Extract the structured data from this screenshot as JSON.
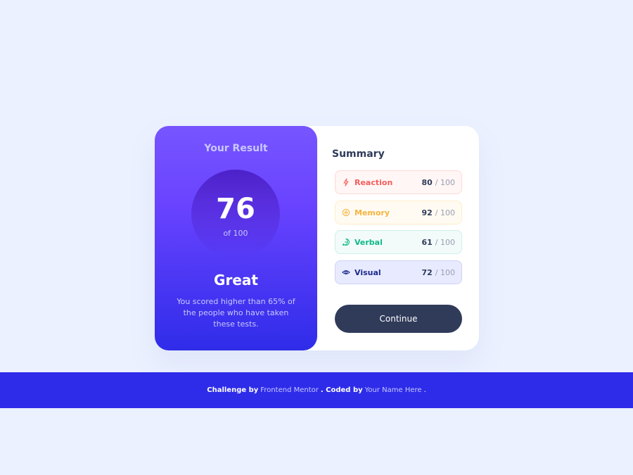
{
  "result": {
    "title": "Your Result",
    "score": "76",
    "score_of": "of 100",
    "rating": "Great",
    "description": "You scored higher than 65% of the people who have taken these tests."
  },
  "summary": {
    "title": "Summary",
    "items": [
      {
        "label": "Reaction",
        "score": "80",
        "max": "/ 100",
        "icon": "lightning-icon",
        "color": "#f55e5e"
      },
      {
        "label": "Memory",
        "score": "92",
        "max": "/ 100",
        "icon": "brain-icon",
        "color": "#f5b43f"
      },
      {
        "label": "Verbal",
        "score": "61",
        "max": "/ 100",
        "icon": "chat-bubble-icon",
        "color": "#10b98a"
      },
      {
        "label": "Visual",
        "score": "72",
        "max": "/ 100",
        "icon": "eye-icon",
        "color": "#1d2b8c"
      }
    ],
    "continue_label": "Continue"
  },
  "footer": {
    "challenge_prefix": "Challenge by",
    "challenge_link": "Frontend Mentor",
    "coded_prefix": ". Coded by",
    "coded_link": "Your Name Here",
    "suffix": "."
  },
  "colors": {
    "background": "#ebf1ff",
    "gradient_top": "#7755ff",
    "gradient_bottom": "#2f2ce9",
    "button": "#303b5a",
    "footer": "#2e2ce9"
  }
}
